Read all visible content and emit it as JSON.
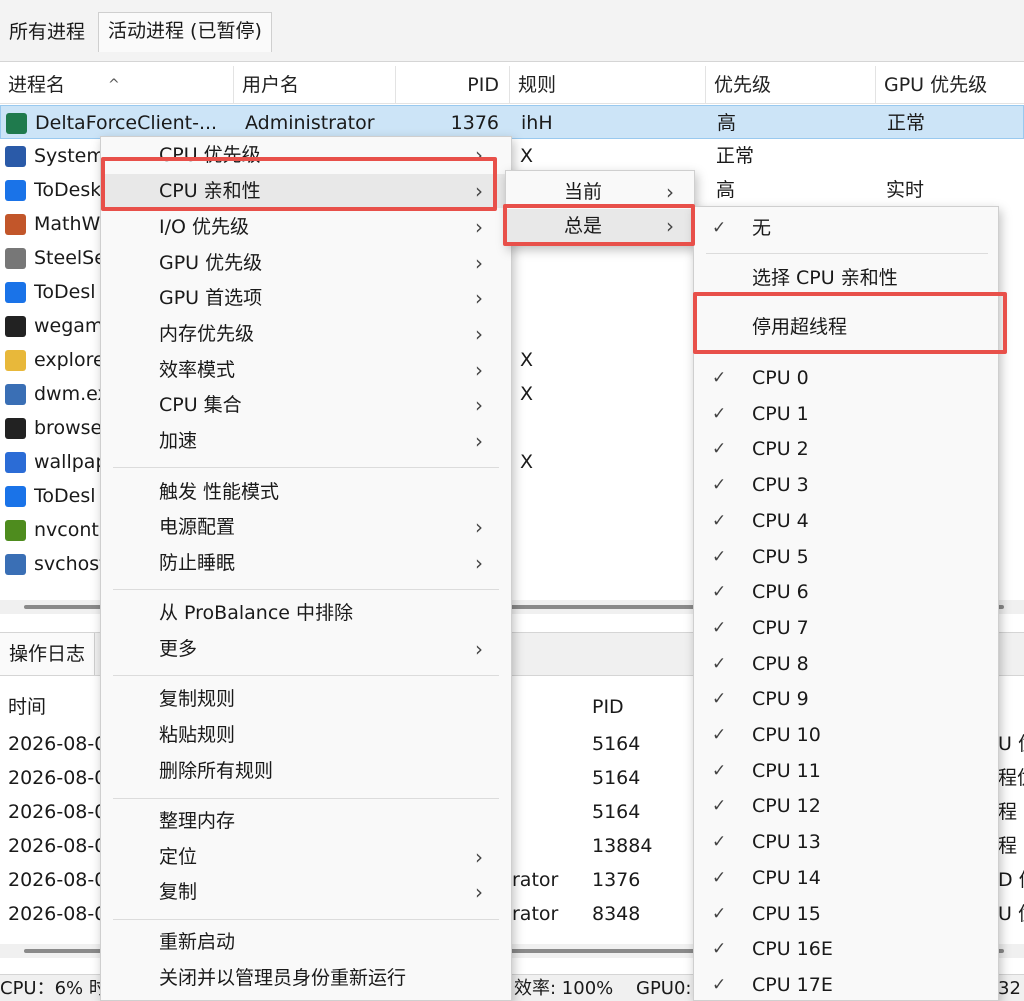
{
  "tabs": {
    "all": "所有进程",
    "active": "活动进程 (已暂停)"
  },
  "columns": {
    "name": "进程名",
    "user": "用户名",
    "pid": "PID",
    "rule": "规则",
    "priority": "优先级",
    "gpu_priority": "GPU 优先级"
  },
  "rows": [
    {
      "name": "DeltaForceClient-...",
      "user": "Administrator",
      "pid": "1376",
      "rule": "ihH",
      "priority": "高",
      "gpu": "正常",
      "icon_color": "#1f7a4d"
    },
    {
      "name": "System",
      "user": "",
      "pid": "",
      "rule": "X",
      "priority": "正常",
      "gpu": "",
      "icon_color": "#2a5aa8"
    },
    {
      "name": "ToDesk",
      "user": "",
      "pid": "",
      "rule": "",
      "priority": "高",
      "gpu": "实时",
      "icon_color": "#1a73e8"
    },
    {
      "name": "MathW",
      "user": "",
      "pid": "",
      "rule": "",
      "priority": "",
      "gpu": "",
      "icon_color": "#c2562a"
    },
    {
      "name": "SteelSe",
      "user": "",
      "pid": "",
      "rule": "",
      "priority": "",
      "gpu": "",
      "icon_color": "#777777"
    },
    {
      "name": "ToDesl",
      "user": "",
      "pid": "",
      "rule": "",
      "priority": "",
      "gpu": "",
      "icon_color": "#1a73e8"
    },
    {
      "name": "wegam",
      "user": "",
      "pid": "",
      "rule": "",
      "priority": "",
      "gpu": "",
      "icon_color": "#222222"
    },
    {
      "name": "explore",
      "user": "",
      "pid": "",
      "rule": "X",
      "priority": "",
      "gpu": "",
      "icon_color": "#e8b83a"
    },
    {
      "name": "dwm.ex",
      "user": "",
      "pid": "",
      "rule": "X",
      "priority": "",
      "gpu": "",
      "icon_color": "#3a6fb5"
    },
    {
      "name": "browse",
      "user": "",
      "pid": "",
      "rule": "",
      "priority": "",
      "gpu": "",
      "icon_color": "#222222"
    },
    {
      "name": "wallpap",
      "user": "",
      "pid": "",
      "rule": "X",
      "priority": "",
      "gpu": "",
      "icon_color": "#2b6cd6"
    },
    {
      "name": "ToDesl",
      "user": "",
      "pid": "",
      "rule": "",
      "priority": "",
      "gpu": "",
      "icon_color": "#1a73e8"
    },
    {
      "name": "nvcont",
      "user": "",
      "pid": "",
      "rule": "",
      "priority": "",
      "gpu": "",
      "icon_color": "#4e8c1e"
    },
    {
      "name": "svchost",
      "user": "",
      "pid": "",
      "rule": "",
      "priority": "",
      "gpu": "",
      "icon_color": "#3a6fb5"
    }
  ],
  "log": {
    "tab": "操作日志",
    "col_time": "时间",
    "col_pid": "PID",
    "rows": [
      {
        "time": "2026-08-0",
        "user": "",
        "pid": "5164",
        "tail": "U 优"
      },
      {
        "time": "2026-08-0",
        "user": "",
        "pid": "5164",
        "tail": "程优"
      },
      {
        "time": "2026-08-0",
        "user": "",
        "pid": "5164",
        "tail": "程 C"
      },
      {
        "time": "2026-08-0",
        "user": "",
        "pid": "13884",
        "tail": "程 C"
      },
      {
        "time": "2026-08-0",
        "user": "rator",
        "pid": "1376",
        "tail": "D 优"
      },
      {
        "time": "2026-08-0",
        "user": "rator",
        "pid": "8348",
        "tail": "U 优"
      }
    ]
  },
  "status": {
    "cpu": "CPU：6% 时",
    "efficiency": "效率: 100%",
    "gpu": "GPU0:",
    "tail": "32"
  },
  "context_menu": {
    "items": [
      "CPU 优先级",
      "CPU 亲和性",
      "I/O 优先级",
      "GPU 优先级",
      "GPU 首选项",
      "内存优先级",
      "效率模式",
      "CPU 集合",
      "加速",
      "触发 性能模式",
      "电源配置",
      "防止睡眠",
      "从 ProBalance 中排除",
      "更多",
      "复制规则",
      "粘贴规则",
      "删除所有规则",
      "整理内存",
      "定位",
      "复制",
      "重新启动",
      "关闭并以管理员身份重新运行"
    ],
    "chevron": "›"
  },
  "affinity_menu": {
    "current": "当前",
    "always": "总是"
  },
  "always_menu": {
    "none": "无",
    "select": "选择 CPU 亲和性",
    "disable_ht": "停用超线程",
    "cpus": [
      "CPU 0",
      "CPU 1",
      "CPU 2",
      "CPU 3",
      "CPU 4",
      "CPU 5",
      "CPU 6",
      "CPU 7",
      "CPU 8",
      "CPU 9",
      "CPU 10",
      "CPU 11",
      "CPU 12",
      "CPU 13",
      "CPU 14",
      "CPU 15",
      "CPU 16E",
      "CPU 17E"
    ],
    "check": "✓"
  },
  "colors": {
    "selection": "#cce4f7",
    "highlight_box": "#e8504a"
  }
}
